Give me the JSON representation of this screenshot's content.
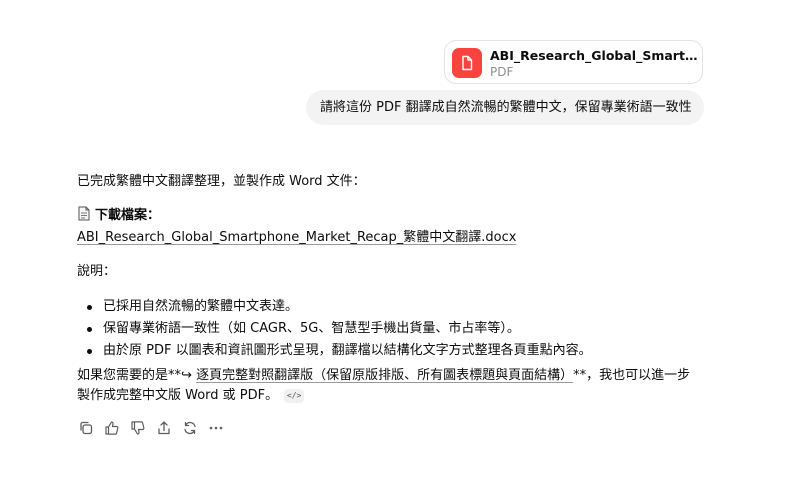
{
  "attachment": {
    "name": "ABI_Research_Global_Smartphone_Market_Recap.pdf",
    "type": "PDF",
    "icon": "pdf-file-icon",
    "icon_color": "#fa423e"
  },
  "user_message": "請將這份 PDF 翻譯成自然流暢的繁體中文，保留專業術語一致性",
  "assistant": {
    "intro": "已完成繁體中文翻譯整理，並製作成 Word 文件：",
    "download_label": "下載檔案：",
    "download_icon": "document-icon",
    "file_link": "ABI_Research_Global_Smartphone_Market_Recap_繁體中文翻譯.docx",
    "notes_heading": "說明：",
    "bullets": [
      "已採用自然流暢的繁體中文表達。",
      "保留專業術語一致性（如 CAGR、5G、智慧型手機出貨量、市占率等）。",
      "由於原 PDF 以圖表和資訊圖形式呈現，翻譯檔以結構化文字方式整理各頁重點內容。"
    ],
    "followup_prefix": "如果您需要的是**",
    "followup_arrow": "↪",
    "followup_link": "逐頁完整對照翻譯版（保留原版排版、所有圖表標題與頁面結構）",
    "followup_suffix": "**，我也可以進一步",
    "followup_line2": "製作成完整中文版 Word 或 PDF。",
    "code_chip": "</>"
  },
  "actions": {
    "copy": "copy-icon",
    "like": "thumbs-up-icon",
    "dislike": "thumbs-down-icon",
    "share": "share-icon",
    "regenerate": "regenerate-icon",
    "more": "more-icon"
  }
}
